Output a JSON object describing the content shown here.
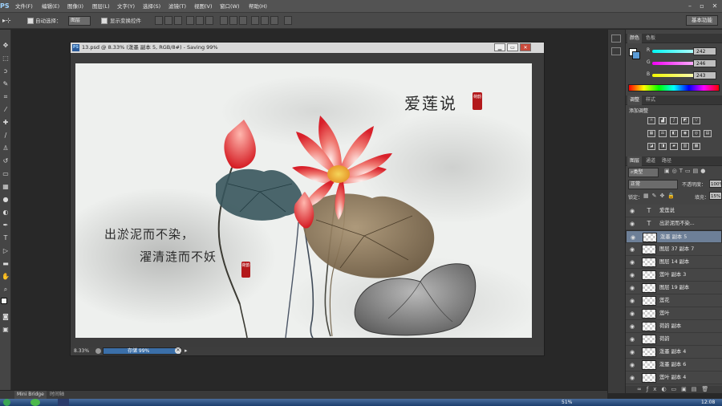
{
  "app": {
    "logo": "PS",
    "workspace": "基本功能"
  },
  "menu": [
    "文件(F)",
    "编辑(E)",
    "图像(I)",
    "图层(L)",
    "文字(Y)",
    "选择(S)",
    "滤镜(T)",
    "视图(V)",
    "窗口(W)",
    "帮助(H)"
  ],
  "options": {
    "auto_select_label": "自动选择：",
    "auto_select_value": "图层",
    "show_transform_label": "显示变换控件"
  },
  "document": {
    "title": "13.psd @ 8.33% (泼墨 副本 5, RGB/8#) - Saving 99%",
    "zoom": "8.33%",
    "save_status": "存储 99%",
    "save_progress": 0.99
  },
  "canvas_text": {
    "title": "爱莲说",
    "line1": "出淤泥而不染，",
    "line2": "濯清涟而不妖",
    "seal_small": "荷韵",
    "seal_top": "荷韵"
  },
  "color_panel": {
    "tabs": [
      "颜色",
      "色板"
    ],
    "channels": [
      {
        "label": "R",
        "value": "242"
      },
      {
        "label": "G",
        "value": "246"
      },
      {
        "label": "B",
        "value": "243"
      }
    ]
  },
  "adjust_panel": {
    "tabs": [
      "调整",
      "样式"
    ],
    "title": "添加调整"
  },
  "layers_panel": {
    "tabs": [
      "图层",
      "通道",
      "路径"
    ],
    "filter": "类型",
    "blend": "正常",
    "opacity_label": "不透明度：",
    "opacity": "100%",
    "lock_label": "锁定：",
    "fill_label": "填充：",
    "fill": "15%",
    "layers": [
      {
        "type": "text",
        "name": "爱莲说"
      },
      {
        "type": "text",
        "name": "出淤泥而不染..."
      },
      {
        "type": "pixel",
        "name": "泼墨 副本 5",
        "selected": true
      },
      {
        "type": "pixel",
        "name": "图层 37 副本 7"
      },
      {
        "type": "pixel",
        "name": "图层 14 副本"
      },
      {
        "type": "pixel",
        "name": "莲叶 副本 3"
      },
      {
        "type": "pixel",
        "name": "图层 19 副本"
      },
      {
        "type": "pixel",
        "name": "莲花"
      },
      {
        "type": "pixel",
        "name": "莲叶"
      },
      {
        "type": "pixel",
        "name": "荷韵 副本"
      },
      {
        "type": "pixel",
        "name": "荷韵"
      },
      {
        "type": "pixel",
        "name": "泼墨 副本 4"
      },
      {
        "type": "pixel",
        "name": "泼墨 副本 6"
      },
      {
        "type": "pixel",
        "name": "莲叶 副本 4"
      }
    ]
  },
  "bottom_tabs": [
    "Mini Bridge",
    "时间轴"
  ],
  "taskbar": {
    "battery": "51%",
    "time": "12:08"
  },
  "colors": {
    "menubar": "#535353",
    "accent": "#6d7f97",
    "progress": "#3b6fa8"
  }
}
